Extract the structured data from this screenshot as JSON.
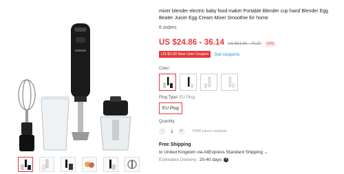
{
  "product": {
    "title": "mixer blender electric baby food maker Portable Blender cup hand Blender Egg Beater Juicer Egg Cream Mixer Smoothie for home",
    "orders": "6 orders",
    "price": "US $24.86 - 36.14",
    "original_price": "US $51.80 - 75.30",
    "discount": "-52%",
    "coupon": "US $3.00 New User Coupon",
    "get_coupons": "Get coupons"
  },
  "options": {
    "color_label": "Color:",
    "plug_label": "Plug Type:",
    "plug_value": "EU Plug",
    "plug_option": "EU Plug",
    "quantity_label": "Quantity:",
    "quantity_minus": "-",
    "quantity_value": "1",
    "quantity_plus": "+",
    "available": "79990 pieces available"
  },
  "shipping": {
    "title": "Free Shipping",
    "line": "to United Kingdom via AliExpress Standard Shipping",
    "chevron": "⌄",
    "delivery_label": "Estimated Delivery:",
    "delivery_dates": "20-40 days",
    "help": "?"
  },
  "icons": {
    "help": "help-circle-icon"
  },
  "colors": {
    "accent": "#e4393c",
    "link": "#2a7dd6"
  }
}
